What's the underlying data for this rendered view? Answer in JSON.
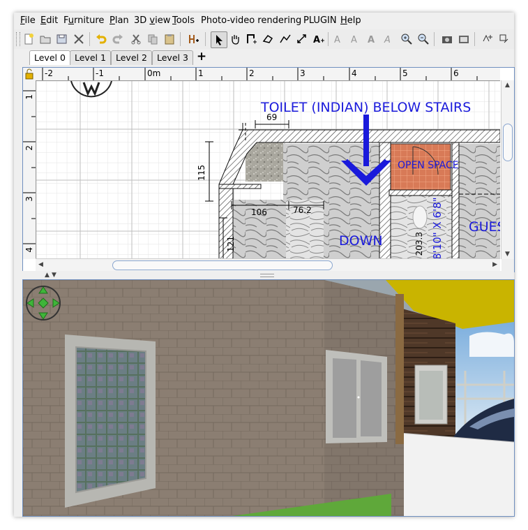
{
  "menu": {
    "items": [
      {
        "pre": "",
        "u": "F",
        "post": "ile"
      },
      {
        "pre": "",
        "u": "E",
        "post": "dit"
      },
      {
        "pre": "F",
        "u": "u",
        "post": "rniture"
      },
      {
        "pre": "",
        "u": "P",
        "post": "lan"
      },
      {
        "pre": "3D ",
        "u": "v",
        "post": "iew"
      },
      {
        "pre": "",
        "u": "T",
        "post": "ools"
      },
      {
        "pre": "Photo-video rendering",
        "u": "",
        "post": ""
      },
      {
        "pre": "PLUGIN",
        "u": "",
        "post": ""
      },
      {
        "pre": "",
        "u": "H",
        "post": "elp"
      }
    ]
  },
  "levels": {
    "tabs": [
      "Level 0",
      "Level 1",
      "Level 2",
      "Level 3"
    ],
    "active": "Level 0",
    "add_label": "+"
  },
  "plan": {
    "ruler_x": [
      "-2",
      "-1",
      "0m",
      "1",
      "2",
      "3",
      "4",
      "5",
      "6"
    ],
    "ruler_y": [
      "1",
      "2",
      "3",
      "4"
    ],
    "labels": {
      "toilet": "TOILET (INDIAN) BELOW STAIRS",
      "open_space": "OPEN SPACE",
      "down": "DOWN",
      "guest": "GUES",
      "size_note": "8'10\" X 6'8\"",
      "small_dim": "203.3"
    },
    "dimensions": {
      "top": "69",
      "left": "115",
      "lower": "106",
      "lower_right": "76.2",
      "side": "121"
    }
  },
  "colors": {
    "accent_blue": "#1a1adb",
    "panel_border": "#6f8fbf",
    "navigator_green": "#3fb53a",
    "ceiling_yellow": "#c9b400",
    "grass_green": "#5fa83a"
  },
  "icons": {
    "navigator": "navigation-arrows-icon"
  }
}
